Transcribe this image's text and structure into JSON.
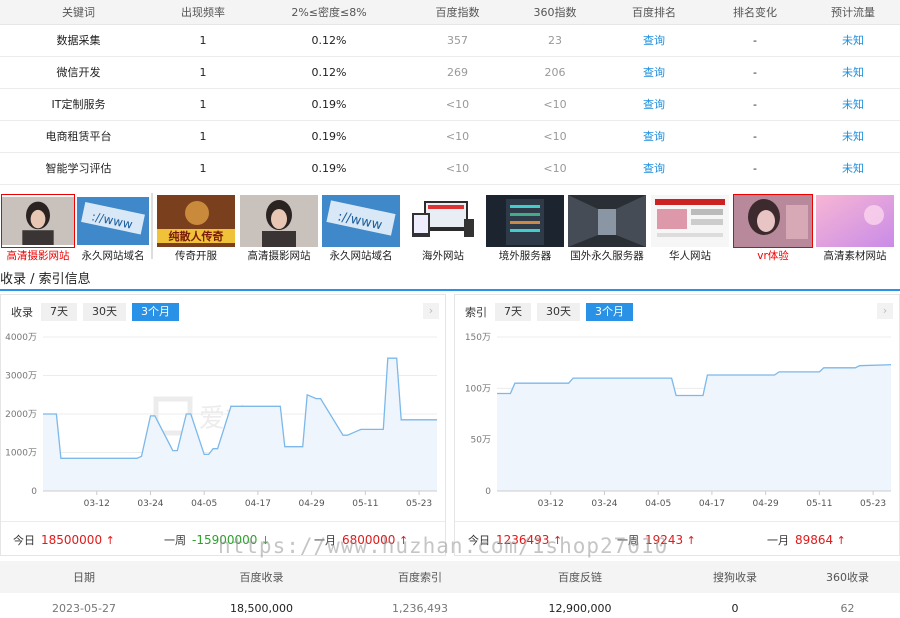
{
  "keyword_table": {
    "headers": [
      "关键词",
      "出现频率",
      "2%≤密度≤8%",
      "百度指数",
      "360指数",
      "百度排名",
      "排名变化",
      "预计流量"
    ],
    "rows": [
      [
        "数据采集",
        "1",
        "0.12%",
        "357",
        "23",
        "查询",
        "-",
        "未知"
      ],
      [
        "微信开发",
        "1",
        "0.12%",
        "269",
        "206",
        "查询",
        "-",
        "未知"
      ],
      [
        "IT定制服务",
        "1",
        "0.19%",
        "<10",
        "<10",
        "查询",
        "-",
        "未知"
      ],
      [
        "电商租赁平台",
        "1",
        "0.19%",
        "<10",
        "<10",
        "查询",
        "-",
        "未知"
      ],
      [
        "智能学习评估",
        "1",
        "0.19%",
        "<10",
        "<10",
        "查询",
        "-",
        "未知"
      ]
    ]
  },
  "thumbnails": [
    {
      "caption": "高清摄影网站",
      "icon": "portrait-photo",
      "highlight": true
    },
    {
      "caption": "永久网站域名",
      "icon": "www-banner",
      "highlight": false
    },
    {
      "caption": "传奇开服",
      "icon": "game-banner",
      "highlight": false,
      "text": "纯散人传奇"
    },
    {
      "caption": "高清摄影网站",
      "icon": "portrait-photo",
      "highlight": false
    },
    {
      "caption": "永久网站域名",
      "icon": "www-banner",
      "highlight": false
    },
    {
      "caption": "海外网站",
      "icon": "devices-mockup",
      "highlight": false
    },
    {
      "caption": "境外服务器",
      "icon": "server-rack",
      "highlight": false
    },
    {
      "caption": "国外永久服务器",
      "icon": "datacenter-aisle",
      "highlight": false
    },
    {
      "caption": "华人网站",
      "icon": "website-screenshot",
      "highlight": false
    },
    {
      "caption": "vr体验",
      "icon": "vr-photo",
      "highlight": true
    },
    {
      "caption": "高清素材网站",
      "icon": "pink-gradient",
      "highlight": false
    }
  ],
  "section_title": "收录 / 索引信息",
  "left_panel": {
    "label": "收录",
    "tabs": [
      "7天",
      "30天",
      "3个月"
    ],
    "active_tab": 2,
    "watermark": "爱站网",
    "stats": [
      {
        "label": "今日",
        "value": "18500000",
        "trend": "up"
      },
      {
        "label": "一周",
        "value": "-15900000",
        "trend": "down"
      },
      {
        "label": "一月",
        "value": "6800000",
        "trend": "up"
      }
    ]
  },
  "right_panel": {
    "label": "索引",
    "tabs": [
      "7天",
      "30天",
      "3个月"
    ],
    "active_tab": 2,
    "watermark": "爱站网",
    "stats": [
      {
        "label": "今日",
        "value": "1236493",
        "trend": "up"
      },
      {
        "label": "一周",
        "value": "19243",
        "trend": "up"
      },
      {
        "label": "一月",
        "value": "89864",
        "trend": "up"
      }
    ]
  },
  "chart_data": [
    {
      "type": "area",
      "xlabel": "",
      "ylabel": "",
      "ylim": [
        0,
        4000
      ],
      "yticks": [
        "0",
        "1000万",
        "2000万",
        "3000万",
        "4000万"
      ],
      "ytick_values": [
        0,
        1000,
        2000,
        3000,
        4000
      ],
      "xticks": [
        "03-12",
        "03-24",
        "04-05",
        "04-17",
        "04-29",
        "05-11",
        "05-23"
      ],
      "xtick_positions": [
        12,
        24,
        36,
        48,
        60,
        72,
        84
      ],
      "x": [
        0,
        3,
        4,
        21,
        22,
        24,
        25,
        29,
        30,
        32,
        33,
        36,
        37,
        38,
        39,
        42,
        43,
        53,
        54,
        58,
        59,
        61,
        62,
        67,
        68,
        70,
        71,
        76,
        77,
        79,
        80,
        82,
        83,
        85,
        86,
        88
      ],
      "values": [
        2000,
        2000,
        850,
        850,
        900,
        1950,
        1950,
        1050,
        1050,
        2000,
        2000,
        950,
        950,
        1100,
        1100,
        2200,
        2200,
        2200,
        1150,
        1150,
        2500,
        2400,
        2400,
        1450,
        1450,
        1550,
        1600,
        1600,
        3450,
        3450,
        1850,
        1850,
        1850,
        1850,
        1850,
        1850
      ]
    },
    {
      "type": "area",
      "xlabel": "",
      "ylabel": "",
      "ylim": [
        0,
        150
      ],
      "yticks": [
        "0",
        "50万",
        "100万",
        "150万"
      ],
      "ytick_values": [
        0,
        50,
        100,
        150
      ],
      "xticks": [
        "03-12",
        "03-24",
        "04-05",
        "04-17",
        "04-29",
        "05-11",
        "05-23"
      ],
      "xtick_positions": [
        12,
        24,
        36,
        48,
        60,
        72,
        84
      ],
      "x": [
        0,
        3,
        4,
        16,
        17,
        39,
        40,
        46,
        47,
        62,
        63,
        72,
        73,
        80,
        81,
        88
      ],
      "values": [
        95,
        95,
        105,
        105,
        110,
        110,
        93,
        93,
        113,
        113,
        116,
        116,
        120,
        120,
        122,
        123
      ]
    }
  ],
  "watermark_text": "https://www.huzhan.com/1shop27010",
  "bottom_table": {
    "headers": [
      "日期",
      "百度收录",
      "百度索引",
      "百度反链",
      "搜狗收录",
      "360收录"
    ],
    "rows": [
      [
        "2023-05-27",
        "18,500,000",
        "1,236,493",
        "12,900,000",
        "0",
        "62"
      ]
    ]
  },
  "colors": {
    "accent": "#2a92e6",
    "up": "#e01a1a",
    "down": "#2aa32a",
    "chart_line": "#7cb8ea",
    "chart_fill": "#eef5fc"
  }
}
